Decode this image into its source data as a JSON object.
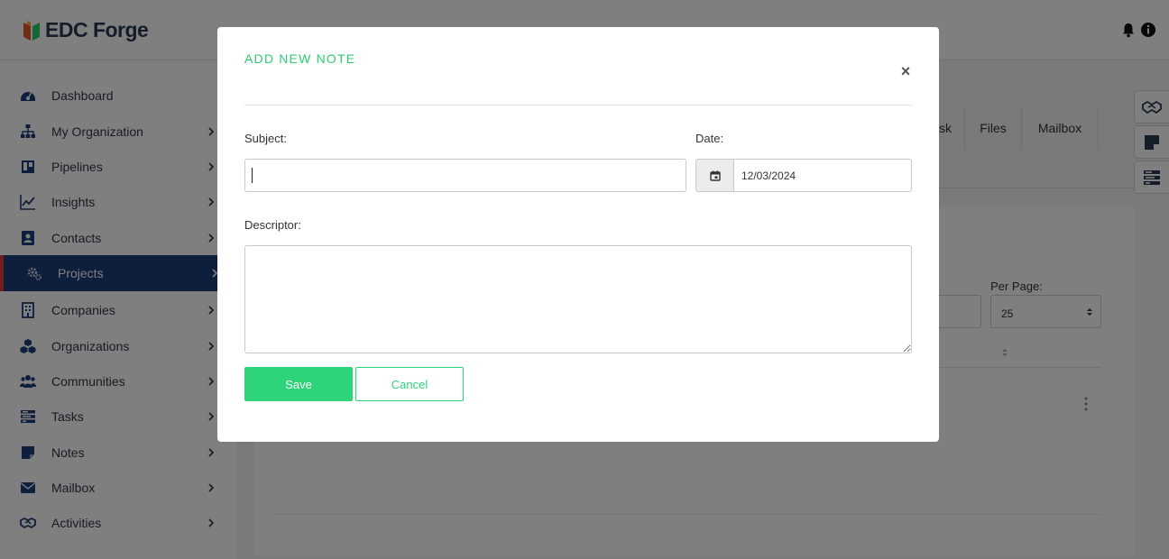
{
  "app": {
    "logo_text": "EDC Forge",
    "colors": {
      "brand": "#2b3a55",
      "accent": "#2ed47a",
      "active_nav": "#1c3d7a",
      "active_marker": "#e53e3e"
    }
  },
  "header": {
    "icons": [
      "bell-icon",
      "info-icon"
    ]
  },
  "sidebar": {
    "items": [
      {
        "label": "Dashboard",
        "icon": "gauge-icon",
        "has_children": false
      },
      {
        "label": "My Organization",
        "icon": "sitemap-icon",
        "has_children": true
      },
      {
        "label": "Pipelines",
        "icon": "pipeline-board-icon",
        "has_children": true
      },
      {
        "label": "Insights",
        "icon": "line-chart-icon",
        "has_children": true
      },
      {
        "label": "Contacts",
        "icon": "contact-card-icon",
        "has_children": true
      },
      {
        "label": "Projects",
        "icon": "gears-icon",
        "has_children": true,
        "active": true
      },
      {
        "label": "Companies",
        "icon": "building-icon",
        "has_children": true
      },
      {
        "label": "Organizations",
        "icon": "cubes-icon",
        "has_children": true
      },
      {
        "label": "Communities",
        "icon": "users-icon",
        "has_children": true
      },
      {
        "label": "Tasks",
        "icon": "tasks-icon",
        "has_children": true
      },
      {
        "label": "Notes",
        "icon": "note-icon",
        "has_children": true
      },
      {
        "label": "Mailbox",
        "icon": "envelope-icon",
        "has_children": true
      },
      {
        "label": "Activities",
        "icon": "handshake-icon",
        "has_children": true
      }
    ]
  },
  "background": {
    "tabs": [
      "sk",
      "Files",
      "Mailbox"
    ],
    "per_page_label": "Per Page:",
    "per_page_value": "25"
  },
  "floating_actions": [
    "handshake-icon",
    "note-icon",
    "tasks-icon"
  ],
  "modal": {
    "title": "ADD NEW NOTE",
    "close_label": "×",
    "subject_label": "Subject:",
    "subject_value": "",
    "date_label": "Date:",
    "date_value": "12/03/2024",
    "descriptor_label": "Descriptor:",
    "descriptor_value": "",
    "save_label": "Save",
    "cancel_label": "Cancel"
  }
}
